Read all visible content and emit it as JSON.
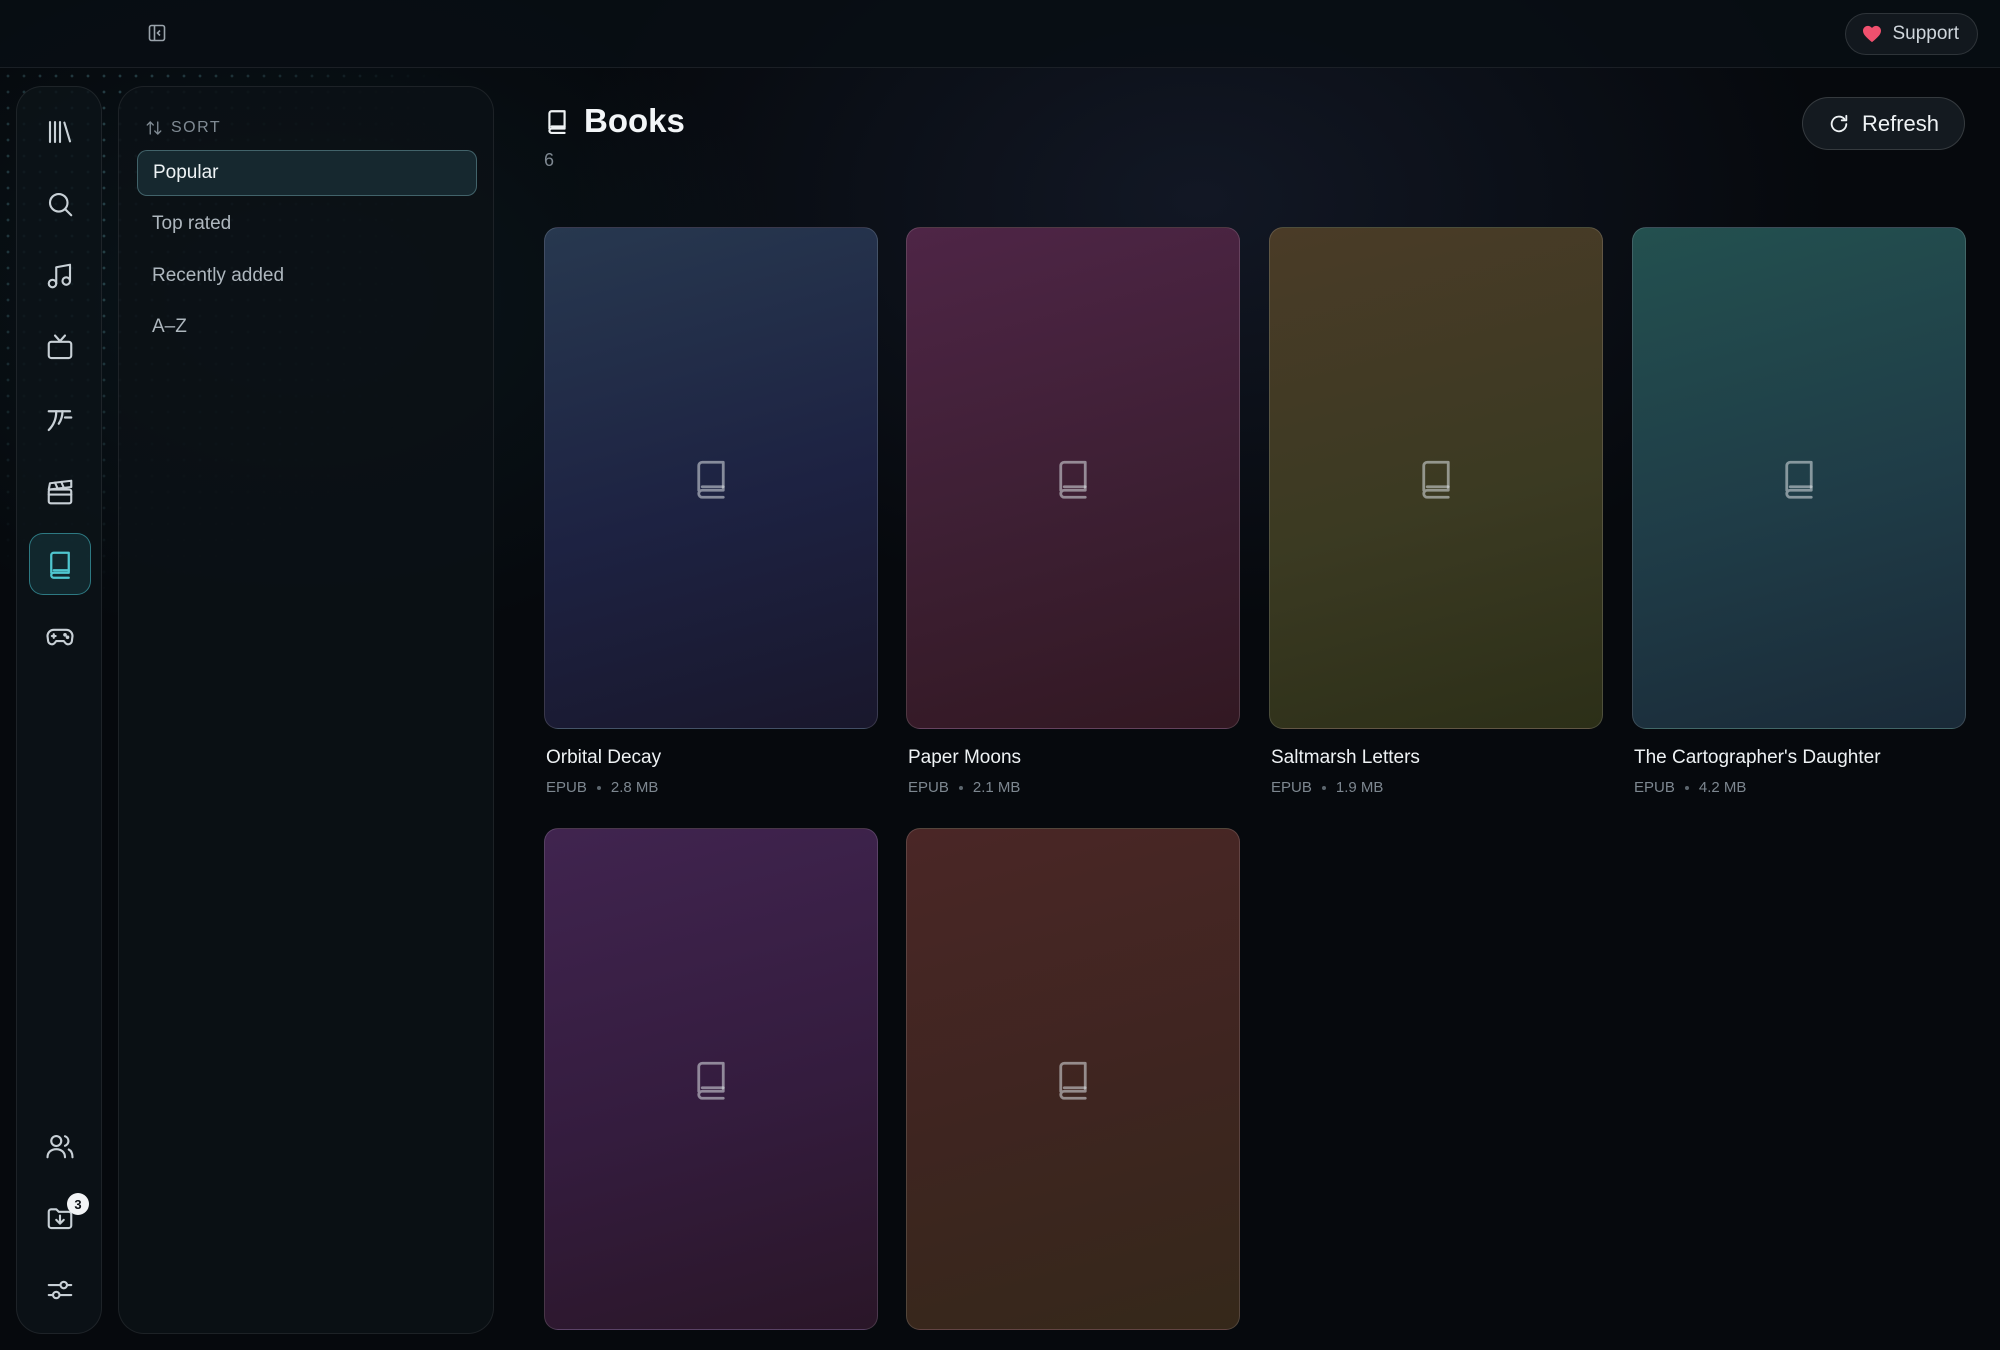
{
  "topbar": {
    "support_label": "Support"
  },
  "nav": {
    "items": [
      {
        "name": "library-icon"
      },
      {
        "name": "search-icon"
      },
      {
        "name": "music-icon"
      },
      {
        "name": "tv-icon"
      },
      {
        "name": "anime-icon"
      },
      {
        "name": "movies-icon"
      },
      {
        "name": "books-icon",
        "active": true
      },
      {
        "name": "games-icon"
      }
    ],
    "bottom": [
      {
        "name": "users-icon"
      },
      {
        "name": "downloads-icon",
        "badge": "3"
      },
      {
        "name": "settings-icon"
      }
    ]
  },
  "sort": {
    "title": "SORT",
    "options": [
      "Popular",
      "Top rated",
      "Recently added",
      "A–Z"
    ],
    "selected": "Popular"
  },
  "main": {
    "title": "Books",
    "count": "6",
    "refresh_label": "Refresh",
    "books": [
      {
        "title": "Orbital Decay",
        "format": "EPUB",
        "size": "2.8 MB"
      },
      {
        "title": "Paper Moons",
        "format": "EPUB",
        "size": "2.1 MB"
      },
      {
        "title": "Saltmarsh Letters",
        "format": "EPUB",
        "size": "1.9 MB"
      },
      {
        "title": "The Cartographer's Daughter",
        "format": "EPUB",
        "size": "4.2 MB"
      },
      {
        "title": "",
        "format": "",
        "size": ""
      },
      {
        "title": "",
        "format": "",
        "size": ""
      }
    ]
  },
  "colors": {
    "accent": "#4fc6cf",
    "support_heart": "#f0506e"
  }
}
